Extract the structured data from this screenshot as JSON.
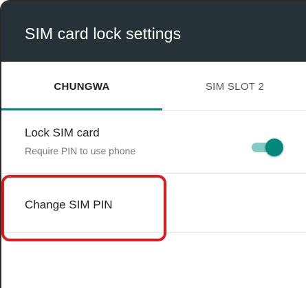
{
  "toolbar": {
    "title": "SIM card lock settings"
  },
  "tabs": [
    {
      "label": "CHUNGWA",
      "active": true
    },
    {
      "label": "SIM SLOT 2",
      "active": false
    }
  ],
  "settings": {
    "lock_sim": {
      "title": "Lock SIM card",
      "summary": "Require PIN to use phone",
      "enabled": true
    },
    "change_pin": {
      "title": "Change SIM PIN"
    }
  },
  "colors": {
    "toolbar_bg": "#263238",
    "accent": "#00897b",
    "highlight": "#e0191d"
  }
}
